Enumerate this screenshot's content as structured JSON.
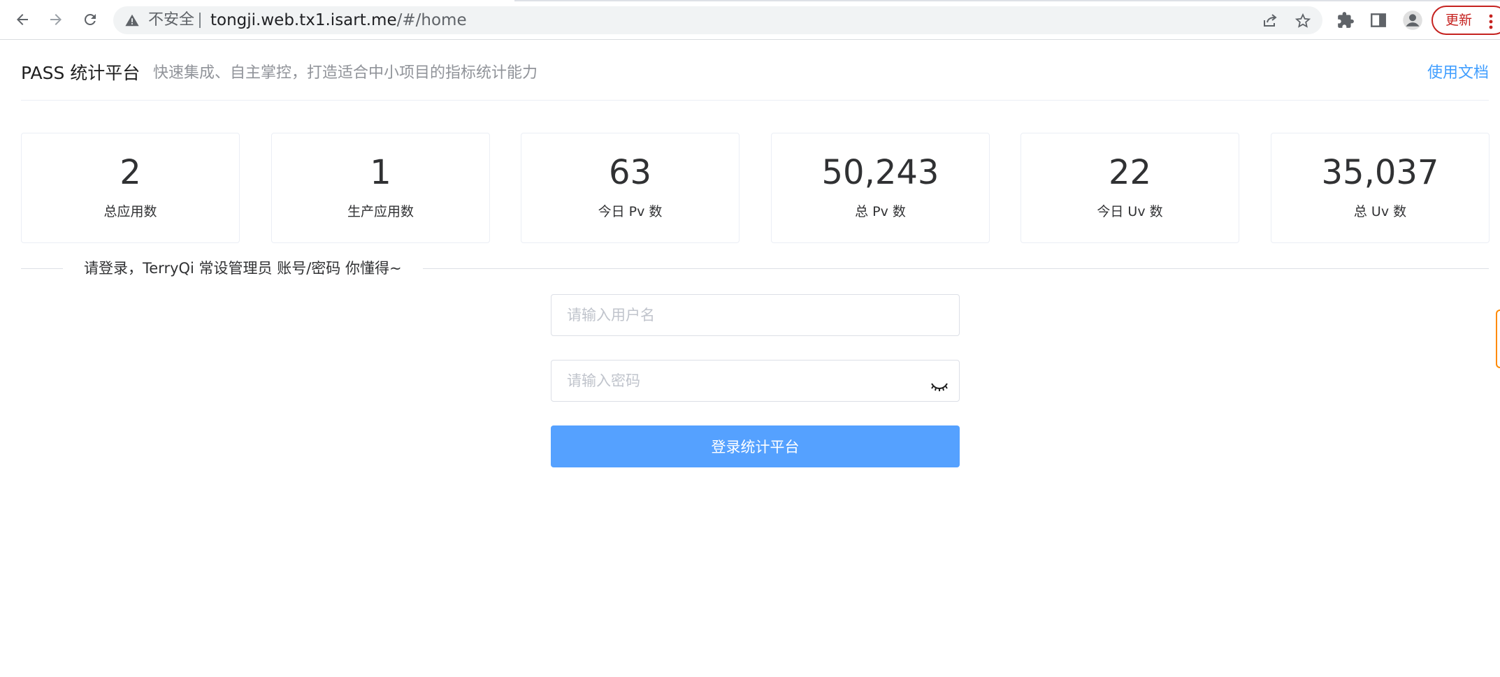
{
  "browser": {
    "security_label": "不安全",
    "url_host": "tongji.web.tx1.isart.me",
    "url_path": "/#/home",
    "update_label": "更新",
    "icons": [
      "back-icon",
      "forward-icon",
      "reload-icon",
      "warning-icon",
      "share-icon",
      "star-icon",
      "extensions-icon",
      "side-panel-icon",
      "profile-icon",
      "menu-dots-icon"
    ]
  },
  "header": {
    "title": "PASS 统计平台",
    "subtitle": "快速集成、自主掌控，打造适合中小项目的指标统计能力",
    "docs_link": "使用文档"
  },
  "stats": [
    {
      "value": "2",
      "label": "总应用数"
    },
    {
      "value": "1",
      "label": "生产应用数"
    },
    {
      "value": "63",
      "label": "今日 Pv 数"
    },
    {
      "value": "50,243",
      "label": "总 Pv 数"
    },
    {
      "value": "22",
      "label": "今日 Uv 数"
    },
    {
      "value": "35,037",
      "label": "总 Uv 数"
    }
  ],
  "login": {
    "divider_text": "请登录，TerryQi 常设管理员 账号/密码 你懂得~",
    "username_placeholder": "请输入用户名",
    "username_value": "",
    "password_placeholder": "请输入密码",
    "password_value": "",
    "submit_label": "登录统计平台"
  },
  "colors": {
    "accent": "#409eff",
    "button": "#55a1ff",
    "update": "#c5221f"
  }
}
